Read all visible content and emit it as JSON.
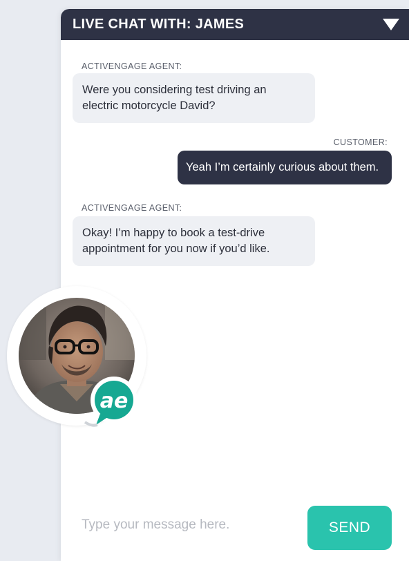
{
  "header": {
    "title": "LIVE CHAT WITH: JAMES"
  },
  "messages": [
    {
      "sender": "ACTIVENGAGE AGENT:",
      "text": "Were you considering test driving an electric motorcycle David?"
    },
    {
      "sender": "CUSTOMER:",
      "text": "Yeah I’m certainly curious about them."
    },
    {
      "sender": "ACTIVENGAGE AGENT:",
      "text": "Okay! I’m happy to book a test-drive appointment for you now if you’d like."
    }
  ],
  "composer": {
    "placeholder": "Type your message here.",
    "send_label": "SEND"
  },
  "badge": {
    "logo_text": "ae"
  },
  "colors": {
    "header_bg": "#2e3245",
    "agent_bubble": "#eef0f4",
    "customer_bubble": "#2e3245",
    "accent": "#2ac3ad",
    "page_bg": "#e8ebf1"
  }
}
